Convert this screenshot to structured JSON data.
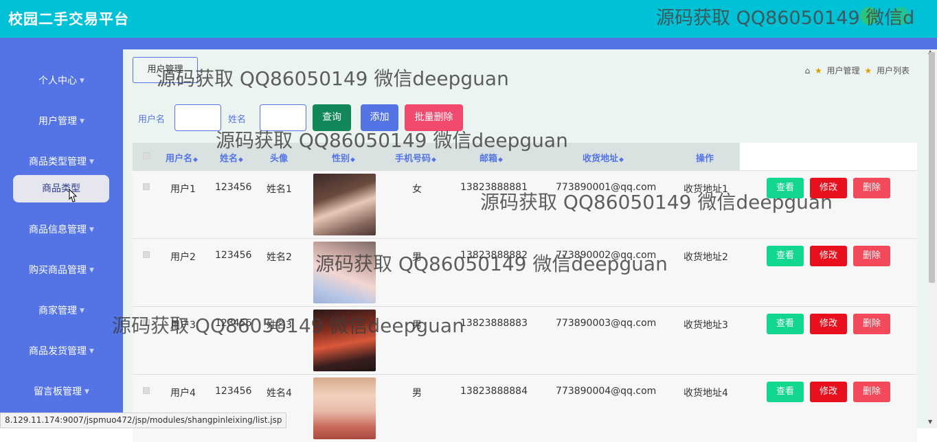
{
  "app": {
    "title": "校园二手交易平台"
  },
  "watermark": "源码获取 QQ86050149 微信deepguan",
  "top_watermark": "源码获取 QQ86050149 微信d",
  "sidebar": {
    "items": [
      {
        "label": "个人中心"
      },
      {
        "label": "用户管理"
      },
      {
        "label": "商品类型管理"
      },
      {
        "label": "商品信息管理"
      },
      {
        "label": "购买商品管理"
      },
      {
        "label": "商家管理"
      },
      {
        "label": "商品发货管理"
      },
      {
        "label": "留言板管理"
      }
    ],
    "active_sub": "商品类型"
  },
  "page": {
    "tab_button": "用户管理",
    "breadcrumb": [
      "用户管理",
      "用户列表"
    ]
  },
  "search": {
    "username_label": "用户名",
    "name_label": "姓名",
    "query_button": "查询",
    "add_button": "添加",
    "batch_delete_button": "批量删除"
  },
  "table": {
    "headers": [
      "用户名",
      "姓名",
      "头像",
      "性别",
      "手机号码",
      "邮箱",
      "收货地址",
      "操作"
    ],
    "rows": [
      {
        "username": "用户1",
        "password": "123456",
        "name": "姓名1",
        "gender": "女",
        "phone": "13823888881",
        "email": "773890001@qq.com",
        "address": "收货地址1"
      },
      {
        "username": "用户2",
        "password": "123456",
        "name": "姓名2",
        "gender": "男",
        "phone": "13823888882",
        "email": "773890002@qq.com",
        "address": "收货地址2"
      },
      {
        "username": "用户3",
        "password": "123456",
        "name": "姓名3",
        "gender": "男",
        "phone": "13823888883",
        "email": "773890003@qq.com",
        "address": "收货地址3"
      },
      {
        "username": "用户4",
        "password": "123456",
        "name": "姓名4",
        "gender": "男",
        "phone": "13823888884",
        "email": "773890004@qq.com",
        "address": "收货地址4"
      }
    ],
    "actions": {
      "view": "查看",
      "edit": "修改",
      "delete": "删除"
    }
  },
  "status_bar": {
    "url": "8.129.11.174:9007/jspmuo472/jsp/modules/shangpinleixing/list.jsp"
  },
  "colors": {
    "topbar": "#00c1d6",
    "sidebar": "#5474e6",
    "query": "#12875a",
    "add": "#5474e6",
    "batch_delete": "#f24a6e",
    "view": "#13d68f",
    "edit": "#e8101c",
    "delete": "#f24a5a"
  }
}
